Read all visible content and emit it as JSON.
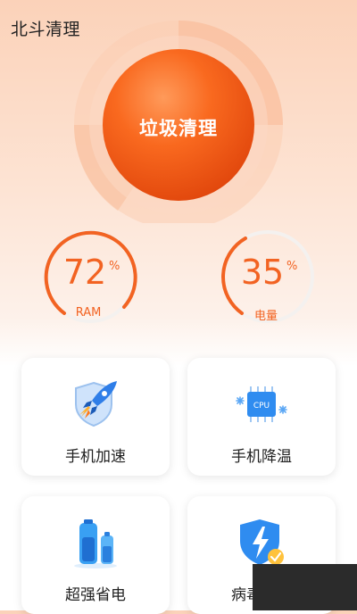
{
  "app": {
    "title": "北斗清理"
  },
  "hero": {
    "button_label": "垃圾清理"
  },
  "gauges": [
    {
      "value": "72",
      "unit": "%",
      "label": "RAM",
      "percent": 72
    },
    {
      "value": "35",
      "unit": "%",
      "label": "电量",
      "percent": 35
    }
  ],
  "cards": [
    {
      "label": "手机加速",
      "icon": "rocket-shield-icon"
    },
    {
      "label": "手机降温",
      "icon": "cpu-cooling-icon",
      "chip_text": "CPU"
    },
    {
      "label": "超强省电",
      "icon": "battery-icon"
    },
    {
      "label": "病毒查杀",
      "icon": "shield-lightning-icon"
    }
  ],
  "colors": {
    "accent": "#f26322",
    "accent_light": "#fbd2b9",
    "card_bg": "#ffffff"
  }
}
